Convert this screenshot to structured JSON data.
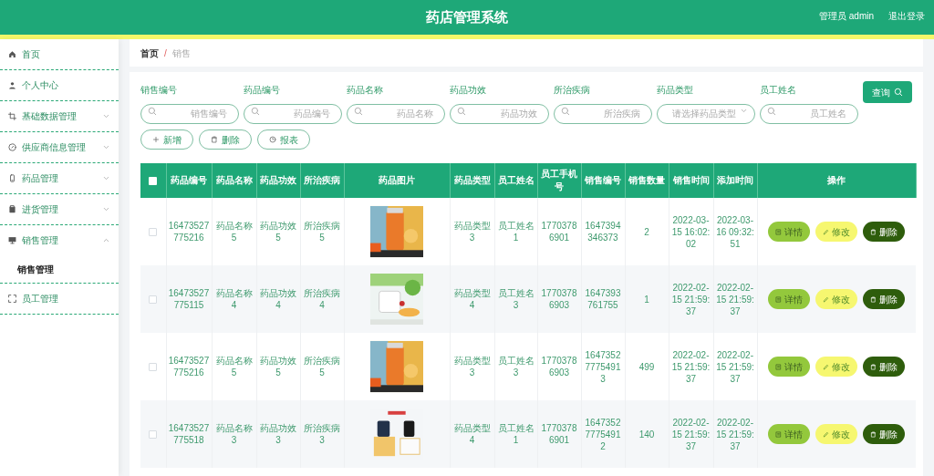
{
  "header": {
    "title": "药店管理系统",
    "user": "管理员 admin",
    "logout": "退出登录"
  },
  "sidebar": {
    "items": [
      {
        "label": "首页"
      },
      {
        "label": "个人中心"
      },
      {
        "label": "基础数据管理",
        "expanded": false
      },
      {
        "label": "供应商信息管理",
        "expanded": false
      },
      {
        "label": "药品管理",
        "expanded": false
      },
      {
        "label": "进货管理",
        "expanded": false
      },
      {
        "label": "销售管理",
        "expanded": true,
        "children": [
          {
            "label": "销售管理",
            "selected": true
          }
        ]
      },
      {
        "label": "员工管理"
      }
    ]
  },
  "breadcrumb": {
    "items": [
      "首页",
      "销售"
    ],
    "separator": "/"
  },
  "filters": [
    {
      "label": "销售编号",
      "placeholder": "销售编号",
      "kind": "search"
    },
    {
      "label": "药品编号",
      "placeholder": "药品编号",
      "kind": "search"
    },
    {
      "label": "药品名称",
      "placeholder": "药品名称",
      "kind": "search"
    },
    {
      "label": "药品功效",
      "placeholder": "药品功效",
      "kind": "search"
    },
    {
      "label": "所治疾病",
      "placeholder": "所治疾病",
      "kind": "search"
    },
    {
      "label": "药品类型",
      "placeholder": "请选择药品类型",
      "kind": "select"
    },
    {
      "label": "员工姓名",
      "placeholder": "员工姓名",
      "kind": "search"
    }
  ],
  "query_button": "查询",
  "toolbar": [
    {
      "label": "新增",
      "kind": "add"
    },
    {
      "label": "删除",
      "kind": "delete"
    },
    {
      "label": "报表",
      "kind": "report"
    }
  ],
  "table": {
    "header_checked": false,
    "columns": [
      "药品编号",
      "药品名称",
      "药品功效",
      "所治疾病",
      "药品图片",
      "药品类型",
      "员工姓名",
      "员工手机号",
      "销售编号",
      "销售数量",
      "销售时间",
      "添加时间",
      "操作"
    ],
    "rows": [
      {
        "checked": false,
        "cells": [
          "16473527775216",
          "药品名称5",
          "药品功效5",
          "所治疾病5",
          "",
          "药品类型3",
          "员工姓名1",
          "17703786901",
          "1647394346373",
          "2",
          "2022-03-15 16:02:02",
          "2022-03-16 09:32:51"
        ],
        "picture": {
          "kind": "picture"
        },
        "actions": [
          {
            "label": "详情",
            "kind": "detail"
          },
          {
            "label": "修改",
            "kind": "edit"
          },
          {
            "label": "删除",
            "kind": "delete"
          }
        ]
      },
      {
        "checked": false,
        "cells": [
          "16473527775115",
          "药品名称4",
          "药品功效4",
          "所治疾病4",
          "",
          "药品类型4",
          "员工姓名3",
          "17703786903",
          "1647393761755",
          "1",
          "2022-02-15 21:59:37",
          "2022-02-15 21:59:37"
        ],
        "picture": {
          "kind": "picture"
        },
        "actions": [
          {
            "label": "详情",
            "kind": "detail"
          },
          {
            "label": "修改",
            "kind": "edit"
          },
          {
            "label": "删除",
            "kind": "delete"
          }
        ]
      },
      {
        "checked": false,
        "cells": [
          "16473527775216",
          "药品名称5",
          "药品功效5",
          "所治疾病5",
          "",
          "药品类型3",
          "员工姓名3",
          "17703786903",
          "164735277754913",
          "499",
          "2022-02-15 21:59:37",
          "2022-02-15 21:59:37"
        ],
        "picture": {
          "kind": "picture"
        },
        "actions": [
          {
            "label": "详情",
            "kind": "detail"
          },
          {
            "label": "修改",
            "kind": "edit"
          },
          {
            "label": "删除",
            "kind": "delete"
          }
        ]
      },
      {
        "checked": false,
        "cells": [
          "16473527775518",
          "药品名称3",
          "药品功效3",
          "所治疾病3",
          "",
          "药品类型4",
          "员工姓名1",
          "17703786901",
          "164735277754912",
          "140",
          "2022-02-15 21:59:37",
          "2022-02-15 21:59:37"
        ],
        "picture": {
          "kind": "picture"
        },
        "actions": [
          {
            "label": "详情",
            "kind": "detail"
          },
          {
            "label": "修改",
            "kind": "edit"
          },
          {
            "label": "删除",
            "kind": "delete"
          }
        ]
      }
    ]
  }
}
